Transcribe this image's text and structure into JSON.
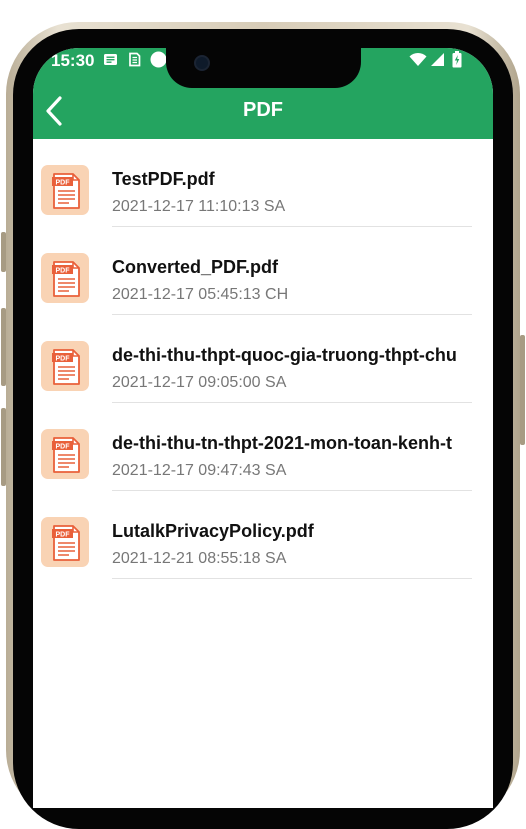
{
  "status_bar": {
    "time": "15:30",
    "icons": [
      "notification-icon",
      "sim-icon",
      "circle-icon",
      "wifi-icon",
      "signal-icon",
      "battery-icon"
    ]
  },
  "app_bar": {
    "title": "PDF",
    "back_icon": "back-arrow-icon"
  },
  "files": [
    {
      "name": "TestPDF.pdf",
      "date": "2021-12-17 11:10:13 SA"
    },
    {
      "name": "Converted_PDF.pdf",
      "date": "2021-12-17 05:45:13 CH"
    },
    {
      "name": "de-thi-thu-thpt-quoc-gia-truong-thpt-chu",
      "date": "2021-12-17 09:05:00 SA"
    },
    {
      "name": "de-thi-thu-tn-thpt-2021-mon-toan-kenh-t",
      "date": "2021-12-17 09:47:43 SA"
    },
    {
      "name": "LutalkPrivacyPolicy.pdf",
      "date": "2021-12-21 08:55:18 SA"
    }
  ],
  "file_icon_label": "PDF",
  "colors": {
    "accent": "#24a460",
    "pdf_icon_bg": "#f9d3b4",
    "pdf_icon_red": "#e9603a"
  }
}
